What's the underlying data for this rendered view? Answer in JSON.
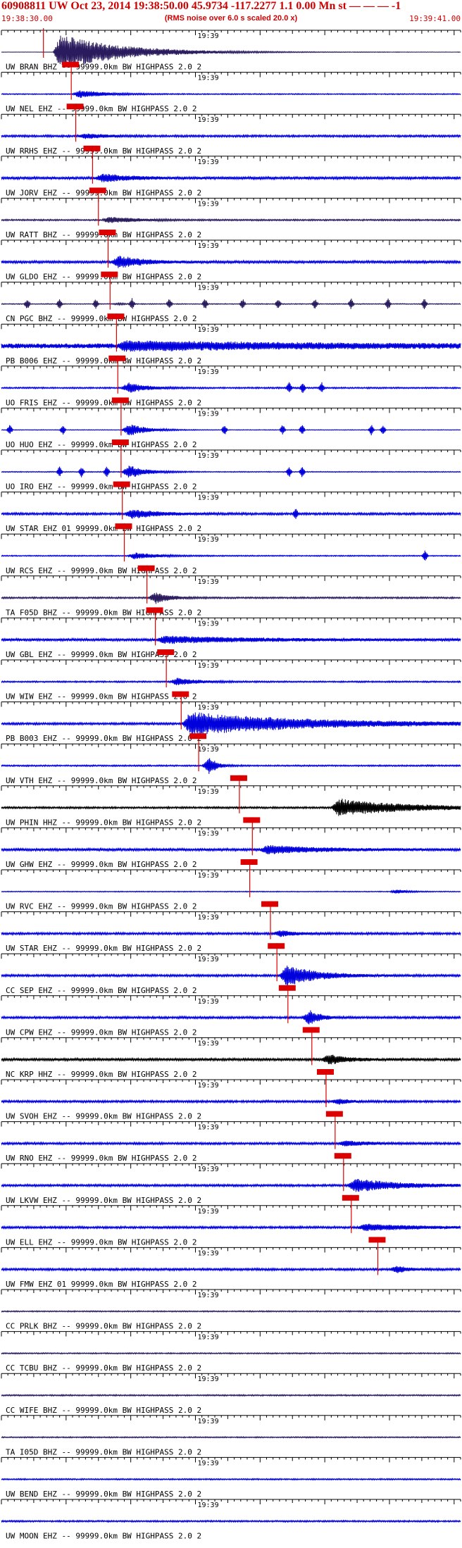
{
  "header": {
    "title": "60908811 UW Oct 23, 2014 19:38:50.00   45.9734 -117.2277  1.1 0.00 Mn st — — — -1",
    "start_time": "19:38:30.00",
    "rms_note": "(RMS noise over 6.0 s scaled 20.0 x)",
    "end_time": "19:39:41.00"
  },
  "colors": {
    "blue": "#0000dd",
    "black": "#000000",
    "purple": "#2a1b5e",
    "pick": "#dd0000"
  },
  "chart_data": {
    "type": "seismogram",
    "time_start": "19:38:30.00",
    "time_end": "19:39:41.00",
    "duration_s": 71,
    "minute_mark_label": "19:39",
    "minute_mark_s": 30,
    "traces": [
      {
        "label": "UW BRAN BHZ -- 99999.0km BW  HIGHPASS  2.0  2",
        "color": "purple",
        "pick_s": 6.5,
        "event": [
          8,
          17,
          7.0
        ],
        "noise": 0.05
      },
      {
        "label": "UW NEL EHZ -- 99999.0km BW  HIGHPASS  2.0  2",
        "color": "blue",
        "pick_s": 10.8,
        "event": [
          11,
          7,
          1.5
        ],
        "noise": 0.14
      },
      {
        "label": "UW RRHS EHZ -- 99999.0km BW  HIGHPASS  2.0  2",
        "color": "blue",
        "pick_s": 11.5,
        "event": [
          11.8,
          6,
          0.9
        ],
        "noise": 0.28
      },
      {
        "label": "UW JORV EHZ -- 99999.0km BW  HIGHPASS  2.0  2",
        "color": "blue",
        "pick_s": 14.1,
        "event": [
          14.5,
          8,
          1.5
        ],
        "noise": 0.35
      },
      {
        "label": "UW RATT BHZ -- 99999.0km BW  HIGHPASS  2.0  2",
        "color": "purple",
        "pick_s": 15,
        "event": [
          15.5,
          8,
          1.2
        ],
        "noise": 0.2
      },
      {
        "label": "UW GLDO EHZ -- 99999.0km BW  HIGHPASS  2.0  2",
        "color": "blue",
        "pick_s": 16.5,
        "event": [
          17,
          6,
          2.5
        ],
        "noise": 0.35
      },
      {
        "label": "CN PGC BHZ -- 99999.0km BW  HIGHPASS  2.0  2",
        "color": "purple",
        "pick_s": 16.8,
        "event": [
          17,
          2,
          0.3
        ],
        "noise": 0.12,
        "spikes": [
          4,
          9,
          14.6,
          20.2,
          26,
          31.5,
          37.3,
          42.8,
          48.5,
          54.1,
          59.8,
          65.4
        ]
      },
      {
        "label": "PB B006 EHZ -- 99999.0km BW  HIGHPASS  2.0  2",
        "color": "blue",
        "pick_s": 17.8,
        "event": [
          18,
          45,
          1.6
        ],
        "noise": 0.7
      },
      {
        "label": "UO FRIS EHZ -- 99999.0km BW  HIGHPASS  2.0  2",
        "color": "blue",
        "pick_s": 18,
        "event": [
          18.5,
          5,
          2
        ],
        "noise": 0.2,
        "spikes": [
          44.5,
          46.6,
          49.5
        ]
      },
      {
        "label": "UO HUO EHZ -- 99999.0km BW  HIGHPASS  2.0  2",
        "color": "blue",
        "pick_s": 18.5,
        "event": [
          18.6,
          5,
          2.5
        ],
        "noise": 0.08,
        "spikes": [
          1.3,
          9.5,
          34.5,
          43.5,
          46.5,
          57.2,
          59
        ]
      },
      {
        "label": "UO IRO EHZ -- 99999.0km BW  HIGHPASS  2.0  2",
        "color": "blue",
        "pick_s": 18.5,
        "event": [
          18.6,
          5,
          2.5
        ],
        "noise": 0.12,
        "spikes": [
          9,
          12.4,
          16.3,
          44.5,
          46.5
        ]
      },
      {
        "label": "UW STAR EHZ 01 99999.0km BW  HIGHPASS  2.0  2",
        "color": "blue",
        "pick_s": 18.7,
        "event": [
          19,
          7,
          1.8
        ],
        "noise": 0.3,
        "spikes": [
          45.5
        ]
      },
      {
        "label": "UW RCS EHZ -- 99999.0km BW  HIGHPASS  2.0  2",
        "color": "blue",
        "pick_s": 19,
        "event": [
          19.5,
          6,
          1.3
        ],
        "noise": 0.15,
        "spikes": [
          65.5
        ]
      },
      {
        "label": "TA F05D BHZ -- 99999.0km BW  HIGHPASS  2.0  2",
        "color": "purple",
        "pick_s": 22.5,
        "event": [
          22.7,
          4,
          2.2
        ],
        "noise": 0.22
      },
      {
        "label": "UW GBL EHZ -- 99999.0km BW  HIGHPASS  2.0  2",
        "color": "blue",
        "pick_s": 23.8,
        "event": [
          24,
          24,
          1.3
        ],
        "noise": 0.35
      },
      {
        "label": "UW WIW EHZ -- 99999.0km BW  HIGHPASS  2.0  2",
        "color": "blue",
        "pick_s": 25.5,
        "event": [
          26,
          6,
          1.4
        ],
        "noise": 0.2
      },
      {
        "label": "PB B003 EHZ -- 99999.0km BW  HIGHPASS  2.0  2",
        "color": "blue",
        "pick_s": 27.8,
        "event": [
          28,
          33,
          4.5
        ],
        "noise": 0.3
      },
      {
        "label": "UW VTH EHZ -- 99999.0km BW  HIGHPASS  2.0  2",
        "color": "blue",
        "pick_s": 30.5,
        "event": [
          31,
          2,
          3.5
        ],
        "noise": 0.2
      },
      {
        "label": "UW PHIN HHZ -- 99999.0km BW  HIGHPASS  2.0  2",
        "color": "black",
        "pick_s": 36.8,
        "event": [
          51,
          19,
          3.3
        ],
        "noise": 0.25
      },
      {
        "label": "UW GHW EHZ -- 99999.0km BW  HIGHPASS  2.0  2",
        "color": "blue",
        "pick_s": 38.8,
        "event": [
          40,
          14,
          1.6
        ],
        "noise": 0.35
      },
      {
        "label": "UW RVC EHZ -- 99999.0km BW  HIGHPASS  2.0  2",
        "color": "blue",
        "pick_s": 38.4,
        "event": [
          60,
          3,
          0.8
        ],
        "noise": 0.12
      },
      {
        "label": "UW STAR EHZ -- 99999.0km BW  HIGHPASS  2.0  2",
        "color": "blue",
        "pick_s": 41.6,
        "event": [
          42,
          4,
          1.2
        ],
        "noise": 0.3
      },
      {
        "label": "CC SEP EHZ -- 99999.0km BW  HIGHPASS  2.0  2",
        "color": "blue",
        "pick_s": 42.6,
        "event": [
          43,
          8,
          4.2
        ],
        "noise": 0.3
      },
      {
        "label": "UW CPW EHZ -- 99999.0km BW  HIGHPASS  2.0  2",
        "color": "blue",
        "pick_s": 44.3,
        "event": [
          46.5,
          3,
          2.8
        ],
        "noise": 0.3
      },
      {
        "label": "NC KRP HHZ -- 99999.0km BW  HIGHPASS  2.0  2",
        "color": "black",
        "pick_s": 48,
        "event": [
          49.5,
          5,
          1.8
        ],
        "noise": 0.35
      },
      {
        "label": "UW SVOH EHZ -- 99999.0km BW  HIGHPASS  2.0  2",
        "color": "blue",
        "pick_s": 50.2,
        "event": [
          51,
          3,
          1
        ],
        "noise": 0.3
      },
      {
        "label": "UW RNO EHZ -- 99999.0km BW  HIGHPASS  2.0  2",
        "color": "blue",
        "pick_s": 51.6,
        "event": [
          52,
          6,
          1
        ],
        "noise": 0.3
      },
      {
        "label": "UW LKVW EHZ -- 99999.0km BW  HIGHPASS  2.0  2",
        "color": "blue",
        "pick_s": 52.9,
        "event": [
          53.5,
          12,
          2.6
        ],
        "noise": 0.3
      },
      {
        "label": "UW ELL EHZ -- 99999.0km BW  HIGHPASS  2.0  2",
        "color": "blue",
        "pick_s": 54.1,
        "event": [
          55,
          15,
          1.2
        ],
        "noise": 0.3
      },
      {
        "label": "UW FMW EHZ 01 99999.0km BW  HIGHPASS  2.0  2",
        "color": "blue",
        "pick_s": 58.2,
        "event": [
          60,
          3,
          1.3
        ],
        "noise": 0.3
      },
      {
        "label": "CC PRLK BHZ -- 99999.0km BW  HIGHPASS  2.0  2",
        "color": "purple",
        "pick_s": null,
        "event": null,
        "noise": 0.16
      },
      {
        "label": "CC TCBU BHZ -- 99999.0km BW  HIGHPASS  2.0  2",
        "color": "purple",
        "pick_s": null,
        "event": null,
        "noise": 0.16
      },
      {
        "label": "CC WIFE BHZ -- 99999.0km BW  HIGHPASS  2.0  2",
        "color": "purple",
        "pick_s": null,
        "event": null,
        "noise": 0.18
      },
      {
        "label": "TA I05D BHZ -- 99999.0km BW  HIGHPASS  2.0  2",
        "color": "purple",
        "pick_s": null,
        "event": null,
        "noise": 0.16
      },
      {
        "label": "UW BEND EHZ -- 99999.0km BW  HIGHPASS  2.0  2",
        "color": "blue",
        "pick_s": null,
        "event": null,
        "noise": 0.18
      },
      {
        "label": "UW MOON EHZ -- 99999.0km BW  HIGHPASS  2.0  2",
        "color": "blue",
        "pick_s": null,
        "event": null,
        "noise": 0.22
      }
    ]
  }
}
